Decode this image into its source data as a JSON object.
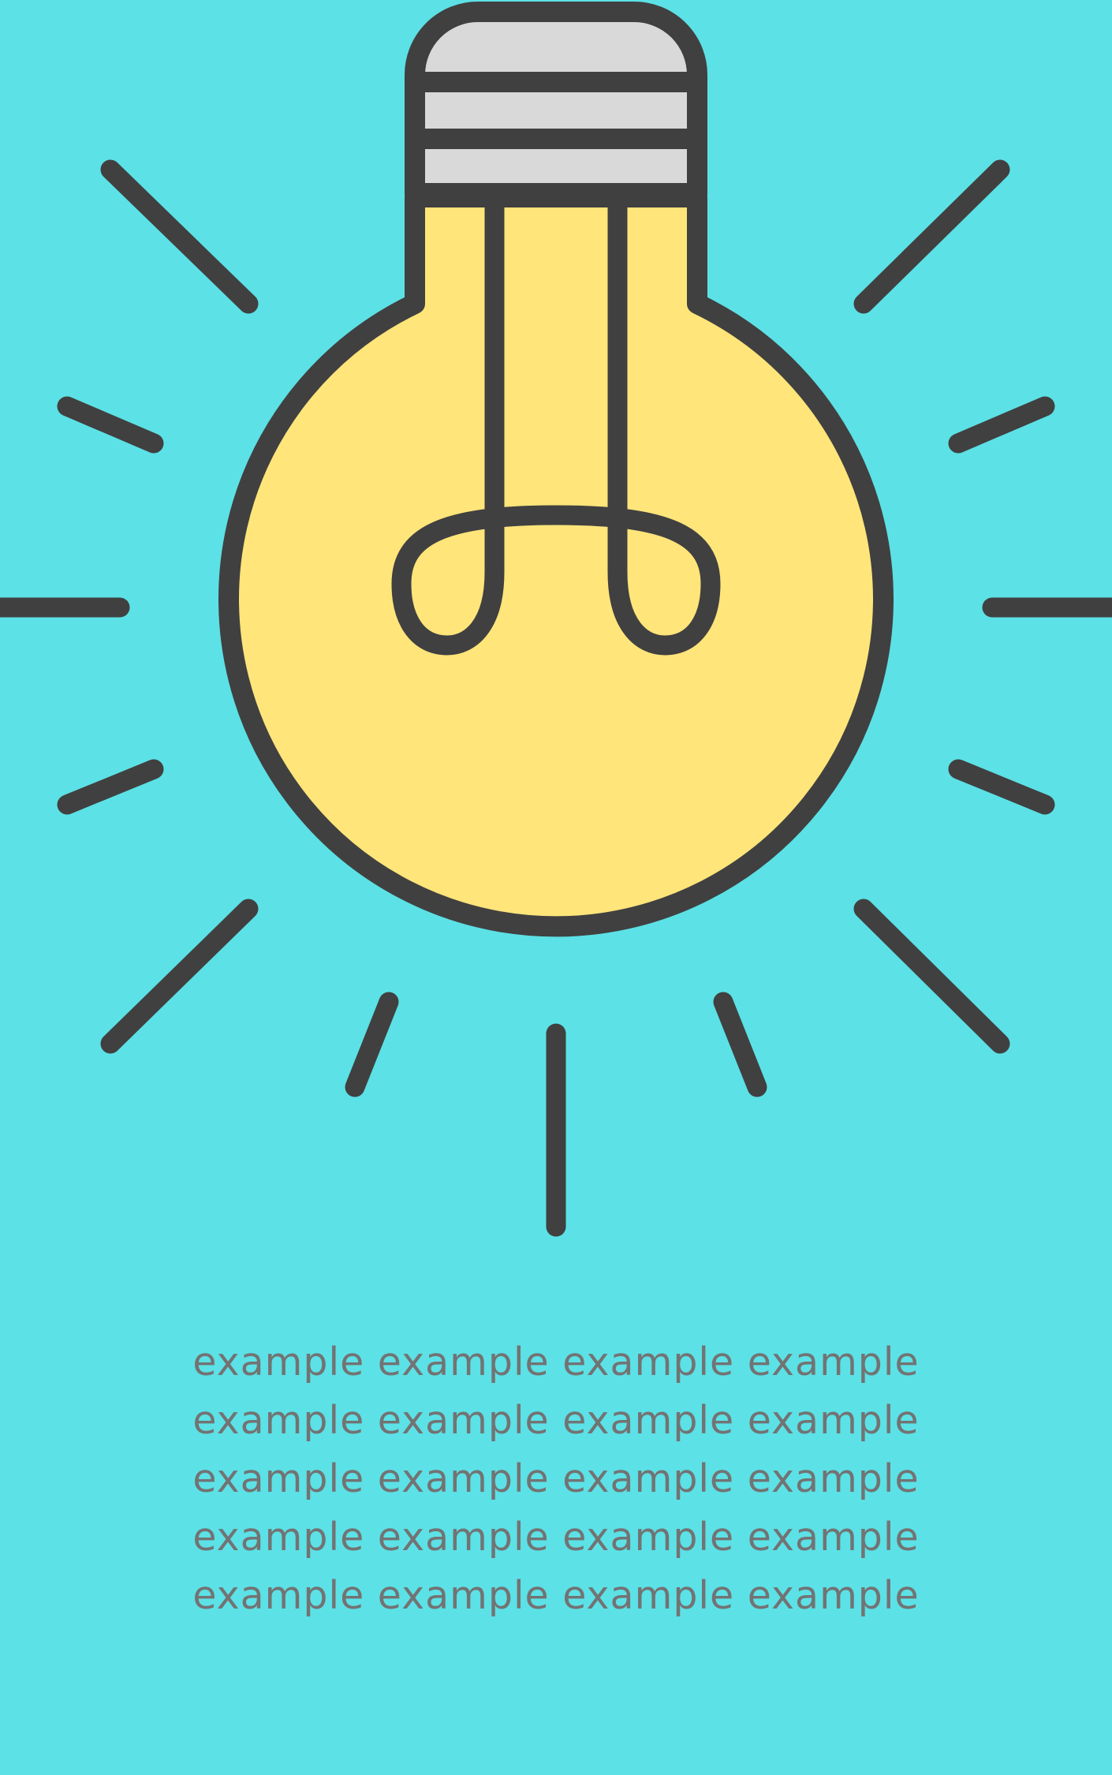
{
  "colors": {
    "background": "#5CE1E6",
    "stroke": "#404040",
    "bulb_fill": "#FFE57A",
    "cap_fill": "#D9D9D9",
    "text": "#737373"
  },
  "illustration": {
    "icon": "lightbulb-icon",
    "rays_icon": "light-rays-icon"
  },
  "text_block": {
    "lines": [
      "example example example example",
      "example example example example",
      "example example example example",
      "example example example example",
      "example example example example"
    ]
  }
}
